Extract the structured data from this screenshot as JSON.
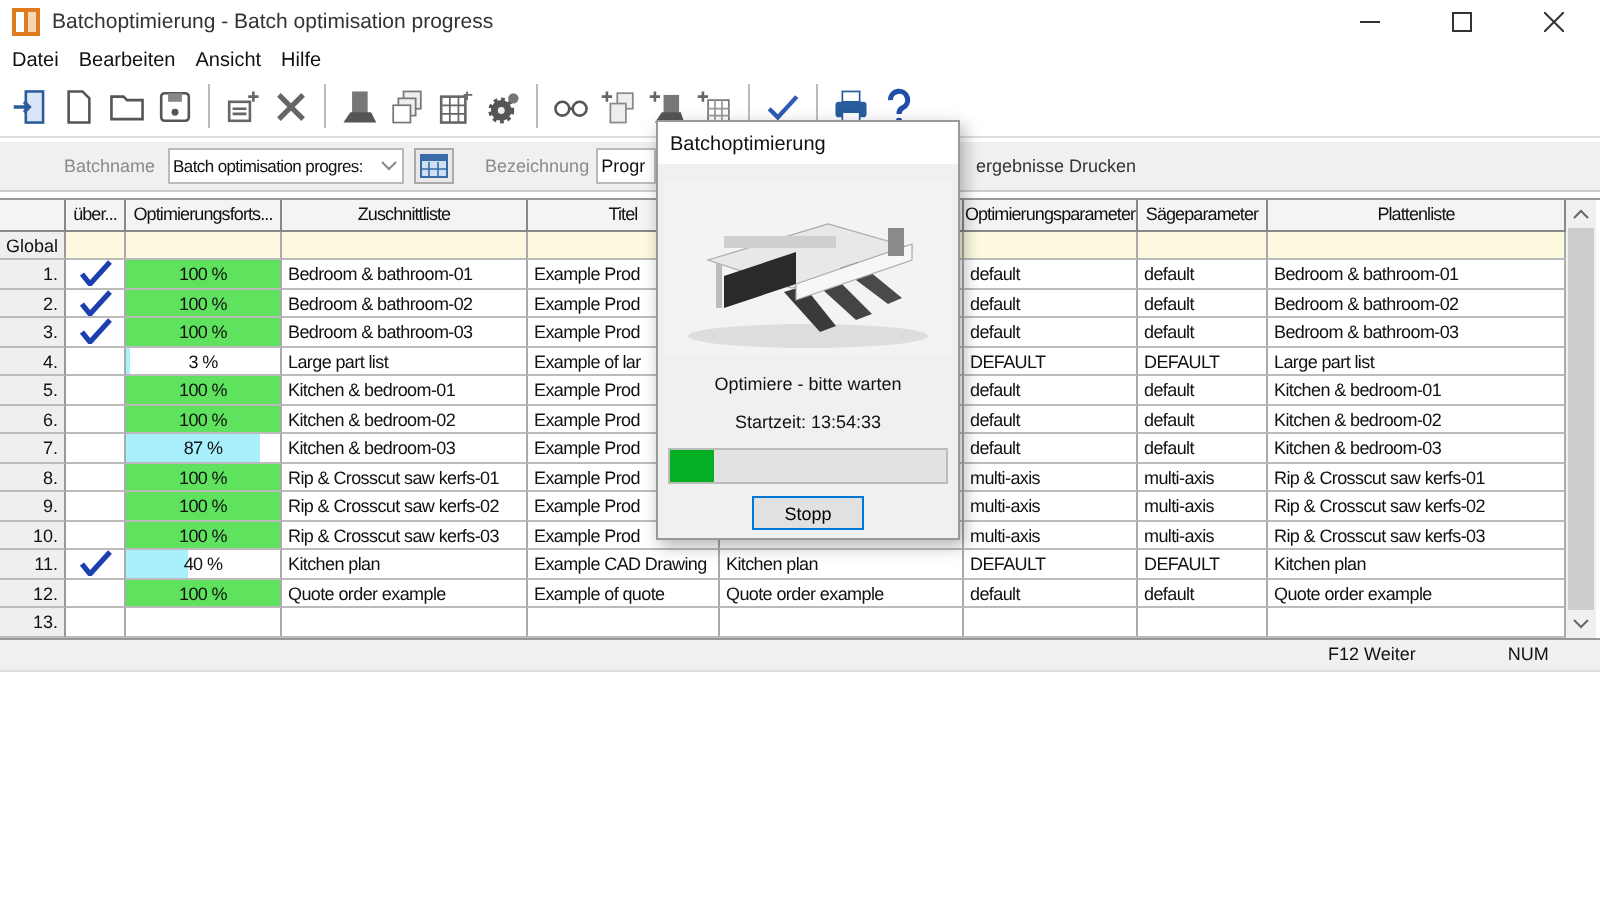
{
  "window": {
    "title": "Batchoptimierung - Batch optimisation progress"
  },
  "menu": [
    "Datei",
    "Bearbeiten",
    "Ansicht",
    "Hilfe"
  ],
  "filter": {
    "batchname_label": "Batchname",
    "batchname_value": "Batch optimisation progres:",
    "bezeichnung_label": "Bezeichnung",
    "bezeichnung_value": "Progr",
    "print_label": "ergebnisse Drucken"
  },
  "table": {
    "columns": [
      "über...",
      "Optimierungsforts...",
      "Zuschnittliste",
      "Titel",
      "Optimierungsparameter",
      "Sägeparameter",
      "Plattenliste"
    ],
    "global_label": "Global",
    "rows": [
      {
        "number": "1.",
        "checked": true,
        "progress": {
          "text": "100 %",
          "level": 1,
          "color": "#5fe35f"
        },
        "zuschnittliste": "Bedroom & bathroom-01",
        "titel": "Example Prod",
        "optimierungsparameter": "default",
        "saegeparameter": "default",
        "plattenliste": "Bedroom & bathroom-01"
      },
      {
        "number": "2.",
        "checked": true,
        "progress": {
          "text": "100 %",
          "level": 1,
          "color": "#5fe35f"
        },
        "zuschnittliste": "Bedroom & bathroom-02",
        "titel": "Example Prod",
        "optimierungsparameter": "default",
        "saegeparameter": "default",
        "plattenliste": "Bedroom & bathroom-02"
      },
      {
        "number": "3.",
        "checked": true,
        "progress": {
          "text": "100 %",
          "level": 1,
          "color": "#5fe35f"
        },
        "zuschnittliste": "Bedroom & bathroom-03",
        "titel": "Example Prod",
        "optimierungsparameter": "default",
        "saegeparameter": "default",
        "plattenliste": "Bedroom & bathroom-03"
      },
      {
        "number": "4.",
        "checked": false,
        "progress": {
          "text": "3 %",
          "level": 0.03,
          "color": "#a8f0fb"
        },
        "zuschnittliste": "Large part list",
        "titel": "Example of lar",
        "optimierungsparameter": "DEFAULT",
        "saegeparameter": "DEFAULT",
        "plattenliste": "Large part list"
      },
      {
        "number": "5.",
        "checked": false,
        "progress": {
          "text": "100 %",
          "level": 1,
          "color": "#5fe35f"
        },
        "zuschnittliste": "Kitchen & bedroom-01",
        "titel": "Example Prod",
        "optimierungsparameter": "default",
        "saegeparameter": "default",
        "plattenliste": "Kitchen & bedroom-01"
      },
      {
        "number": "6.",
        "checked": false,
        "progress": {
          "text": "100 %",
          "level": 1,
          "color": "#5fe35f"
        },
        "zuschnittliste": "Kitchen & bedroom-02",
        "titel": "Example Prod",
        "optimierungsparameter": "default",
        "saegeparameter": "default",
        "plattenliste": "Kitchen & bedroom-02"
      },
      {
        "number": "7.",
        "checked": false,
        "progress": {
          "text": "87 %",
          "level": 0.87,
          "color": "#a8f0fb"
        },
        "zuschnittliste": "Kitchen & bedroom-03",
        "titel": "Example Prod",
        "optimierungsparameter": "default",
        "saegeparameter": "default",
        "plattenliste": "Kitchen & bedroom-03"
      },
      {
        "number": "8.",
        "checked": false,
        "progress": {
          "text": "100 %",
          "level": 1,
          "color": "#5fe35f"
        },
        "zuschnittliste": "Rip & Crosscut saw kerfs-01",
        "titel": "Example Prod",
        "optimierungsparameter": "multi-axis",
        "saegeparameter": "multi-axis",
        "plattenliste": "Rip & Crosscut saw kerfs-01"
      },
      {
        "number": "9.",
        "checked": false,
        "progress": {
          "text": "100 %",
          "level": 1,
          "color": "#5fe35f"
        },
        "zuschnittliste": "Rip & Crosscut saw kerfs-02",
        "titel": "Example Prod",
        "optimierungsparameter": "multi-axis",
        "saegeparameter": "multi-axis",
        "plattenliste": "Rip & Crosscut saw kerfs-02"
      },
      {
        "number": "10.",
        "checked": false,
        "progress": {
          "text": "100 %",
          "level": 1,
          "color": "#5fe35f"
        },
        "zuschnittliste": "Rip & Crosscut saw kerfs-03",
        "titel": "Example Prod",
        "optimierungsparameter": "multi-axis",
        "saegeparameter": "multi-axis",
        "plattenliste": "Rip & Crosscut saw kerfs-03"
      },
      {
        "number": "11.",
        "checked": true,
        "progress": {
          "text": "40 %",
          "level": 0.4,
          "color": "#a8f0fb"
        },
        "zuschnittliste": "Kitchen plan",
        "titel": "Example CAD Drawing",
        "column_6": "Kitchen plan",
        "optimierungsparameter": "DEFAULT",
        "saegeparameter": "DEFAULT",
        "plattenliste": "Kitchen plan"
      },
      {
        "number": "12.",
        "checked": false,
        "progress": {
          "text": "100 %",
          "level": 1,
          "color": "#5fe35f"
        },
        "zuschnittliste": "Quote order example",
        "titel": "Example of quote",
        "column_6": "Quote order example",
        "optimierungsparameter": "default",
        "saegeparameter": "default",
        "plattenliste": "Quote order example"
      },
      {
        "number": "13.",
        "checked": false
      }
    ]
  },
  "dialog": {
    "title": "Batchoptimierung",
    "message": "Optimiere - bitte warten",
    "start_time": "Startzeit: 13:54:33",
    "level": 0.16,
    "button": "Stopp"
  },
  "status_bar": [
    "F12 Weiter",
    "NUM"
  ]
}
